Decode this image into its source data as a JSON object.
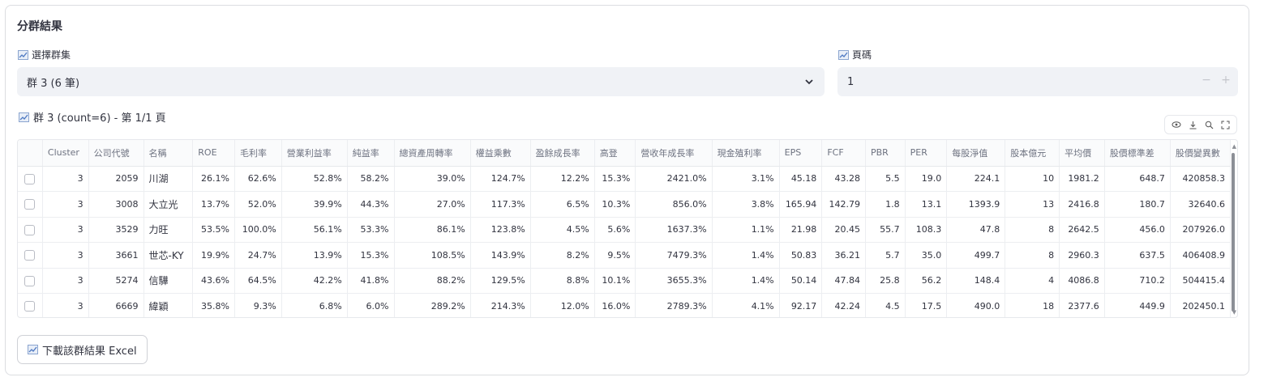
{
  "section_title": "分群結果",
  "cluster_select": {
    "label": "選擇群集",
    "value": "群 3 (6 筆)"
  },
  "page_input": {
    "label": "頁碼",
    "value": "1",
    "minus": "−",
    "plus": "+"
  },
  "table_caption": "群 3 (count=6) - 第 1/1 頁",
  "table": {
    "columns": [
      "Cluster",
      "公司代號",
      "名稱",
      "ROE",
      "毛利率",
      "營業利益率",
      "純益率",
      "總資產周轉率",
      "權益乘數",
      "盈餘成長率",
      "高登",
      "營收年成長率",
      "現金殖利率",
      "EPS",
      "FCF",
      "PBR",
      "PER",
      "每股淨值",
      "股本億元",
      "平均價",
      "股價標準差",
      "股價變異數"
    ],
    "rows": [
      [
        "3",
        "2059",
        "川湖",
        "26.1%",
        "62.6%",
        "52.8%",
        "58.2%",
        "39.0%",
        "124.7%",
        "12.2%",
        "15.3%",
        "2421.0%",
        "3.1%",
        "45.18",
        "43.28",
        "5.5",
        "19.0",
        "224.1",
        "10",
        "1981.2",
        "648.7",
        "420858.3"
      ],
      [
        "3",
        "3008",
        "大立光",
        "13.7%",
        "52.0%",
        "39.9%",
        "44.3%",
        "27.0%",
        "117.3%",
        "6.5%",
        "10.3%",
        "856.0%",
        "3.8%",
        "165.94",
        "142.79",
        "1.8",
        "13.1",
        "1393.9",
        "13",
        "2416.8",
        "180.7",
        "32640.6"
      ],
      [
        "3",
        "3529",
        "力旺",
        "53.5%",
        "100.0%",
        "56.1%",
        "53.3%",
        "86.1%",
        "123.8%",
        "4.5%",
        "5.6%",
        "1637.3%",
        "1.1%",
        "21.98",
        "20.45",
        "55.7",
        "108.3",
        "47.8",
        "8",
        "2642.5",
        "456.0",
        "207926.0"
      ],
      [
        "3",
        "3661",
        "世芯-KY",
        "19.9%",
        "24.7%",
        "13.9%",
        "15.3%",
        "108.5%",
        "143.9%",
        "8.2%",
        "9.5%",
        "7479.3%",
        "1.4%",
        "50.83",
        "36.21",
        "5.7",
        "35.0",
        "499.7",
        "8",
        "2960.3",
        "637.5",
        "406408.9"
      ],
      [
        "3",
        "5274",
        "信驊",
        "43.6%",
        "64.5%",
        "42.2%",
        "41.8%",
        "88.2%",
        "129.5%",
        "8.8%",
        "10.1%",
        "3655.3%",
        "1.4%",
        "50.14",
        "47.84",
        "25.8",
        "56.2",
        "148.4",
        "4",
        "4086.8",
        "710.2",
        "504415.4"
      ],
      [
        "3",
        "6669",
        "緯穎",
        "35.8%",
        "9.3%",
        "6.8%",
        "6.0%",
        "289.2%",
        "214.3%",
        "12.0%",
        "16.0%",
        "2789.3%",
        "4.1%",
        "92.17",
        "42.24",
        "4.5",
        "17.5",
        "490.0",
        "18",
        "2377.6",
        "449.9",
        "202450.1"
      ]
    ]
  },
  "download_button": "下載該群結果 Excel",
  "icons": {
    "label_icon": "chart-line-icon",
    "dropdown": "chevron-down-icon",
    "toolbar": [
      "eye-icon",
      "download-icon",
      "search-icon",
      "fullscreen-icon"
    ]
  },
  "colors": {
    "input_bg": "#f0f2f6",
    "border": "#dcdde1",
    "icon_blue": "#6b8fc6"
  }
}
